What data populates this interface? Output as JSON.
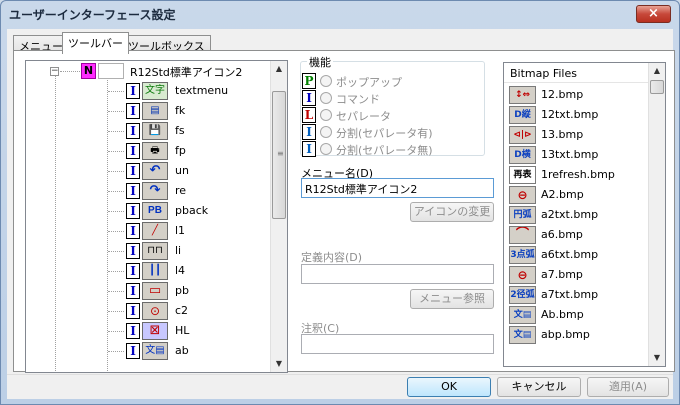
{
  "window": {
    "title": "ユーザーインターフェース設定",
    "close_glyph": "×"
  },
  "tabs": [
    {
      "label": "メニュー"
    },
    {
      "label": "ツールバー",
      "active": true
    },
    {
      "label": "ツールボックス"
    }
  ],
  "tree": {
    "expander": "−",
    "root": {
      "badge": "N",
      "label": "R12Std標準アイコン2"
    },
    "items": [
      {
        "badge": "I",
        "icon": "文字",
        "icon_name": "text-icon",
        "label": "textmenu"
      },
      {
        "badge": "I",
        "icon": "▤",
        "icon_name": "copy-icon",
        "label": "fk"
      },
      {
        "badge": "I",
        "icon": "💾",
        "icon_name": "save-icon",
        "label": "fs"
      },
      {
        "badge": "I",
        "icon": "🖶",
        "icon_name": "print-icon",
        "label": "fp"
      },
      {
        "badge": "I",
        "icon": "↶",
        "icon_name": "undo-icon",
        "label": "un"
      },
      {
        "badge": "I",
        "icon": "↷",
        "icon_name": "redo-icon",
        "label": "re"
      },
      {
        "badge": "I",
        "icon": "PB",
        "icon_name": "pback-icon",
        "label": "pback"
      },
      {
        "badge": "I",
        "icon": "╱",
        "icon_name": "line-icon",
        "label": "l1"
      },
      {
        "badge": "I",
        "icon": "⊓⊓",
        "icon_name": "multiline-icon",
        "label": "li"
      },
      {
        "badge": "I",
        "icon": "┃┃",
        "icon_name": "double-line-icon",
        "label": "l4"
      },
      {
        "badge": "I",
        "icon": "▭",
        "icon_name": "rectangle-icon",
        "label": "pb"
      },
      {
        "badge": "I",
        "icon": "⊙",
        "icon_name": "circle-icon",
        "label": "c2"
      },
      {
        "badge": "I",
        "icon": "⊠",
        "icon_name": "hatch-icon",
        "label": "HL"
      },
      {
        "badge": "I",
        "icon": "文▤",
        "icon_name": "text-box-icon",
        "label": "ab"
      }
    ]
  },
  "function_group": {
    "legend": "機能",
    "options": [
      {
        "badge": "P",
        "badge_color": "#008000",
        "label": "ポップアップ"
      },
      {
        "badge": "I",
        "badge_color": "#0000c0",
        "label": "コマンド"
      },
      {
        "badge": "L",
        "badge_color": "#c00000",
        "label": "セパレータ"
      },
      {
        "badge": "I",
        "badge_color": "#0060c0",
        "label": "分割(セパレータ有)"
      },
      {
        "badge": "I",
        "badge_color": "#0060c0",
        "label": "分割(セパレータ無)"
      }
    ]
  },
  "menu_name": {
    "label": "メニュー名(D)",
    "value": "R12Std標準アイコン2",
    "change_icon_button": "アイコンの変更"
  },
  "definition": {
    "label": "定義内容(D)",
    "value": "",
    "menu_ref_button": "メニュー参照"
  },
  "note": {
    "label": "注釈(C)",
    "value": ""
  },
  "bitmap_files": {
    "header": "Bitmap Files",
    "items": [
      {
        "icon": "↕⇔",
        "label": "12.bmp"
      },
      {
        "icon": "D縦反",
        "label": "12txt.bmp"
      },
      {
        "icon": "⊲|⊳",
        "label": "13.bmp"
      },
      {
        "icon": "D横反",
        "label": "13txt.bmp"
      },
      {
        "icon": "再表示",
        "label": "1refresh.bmp"
      },
      {
        "icon": "⊖",
        "label": "A2.bmp"
      },
      {
        "icon": "円弧",
        "label": "a2txt.bmp"
      },
      {
        "icon": "⌒",
        "label": "a6.bmp"
      },
      {
        "icon": "3点弧",
        "label": "a6txt.bmp"
      },
      {
        "icon": "⊖",
        "label": "a7.bmp"
      },
      {
        "icon": "2径弧",
        "label": "a7txt.bmp"
      },
      {
        "icon": "文▤",
        "label": "Ab.bmp"
      },
      {
        "icon": "文▤",
        "label": "abp.bmp"
      }
    ]
  },
  "footer": {
    "ok": "OK",
    "cancel": "キャンセル",
    "apply": "適用(A)"
  }
}
